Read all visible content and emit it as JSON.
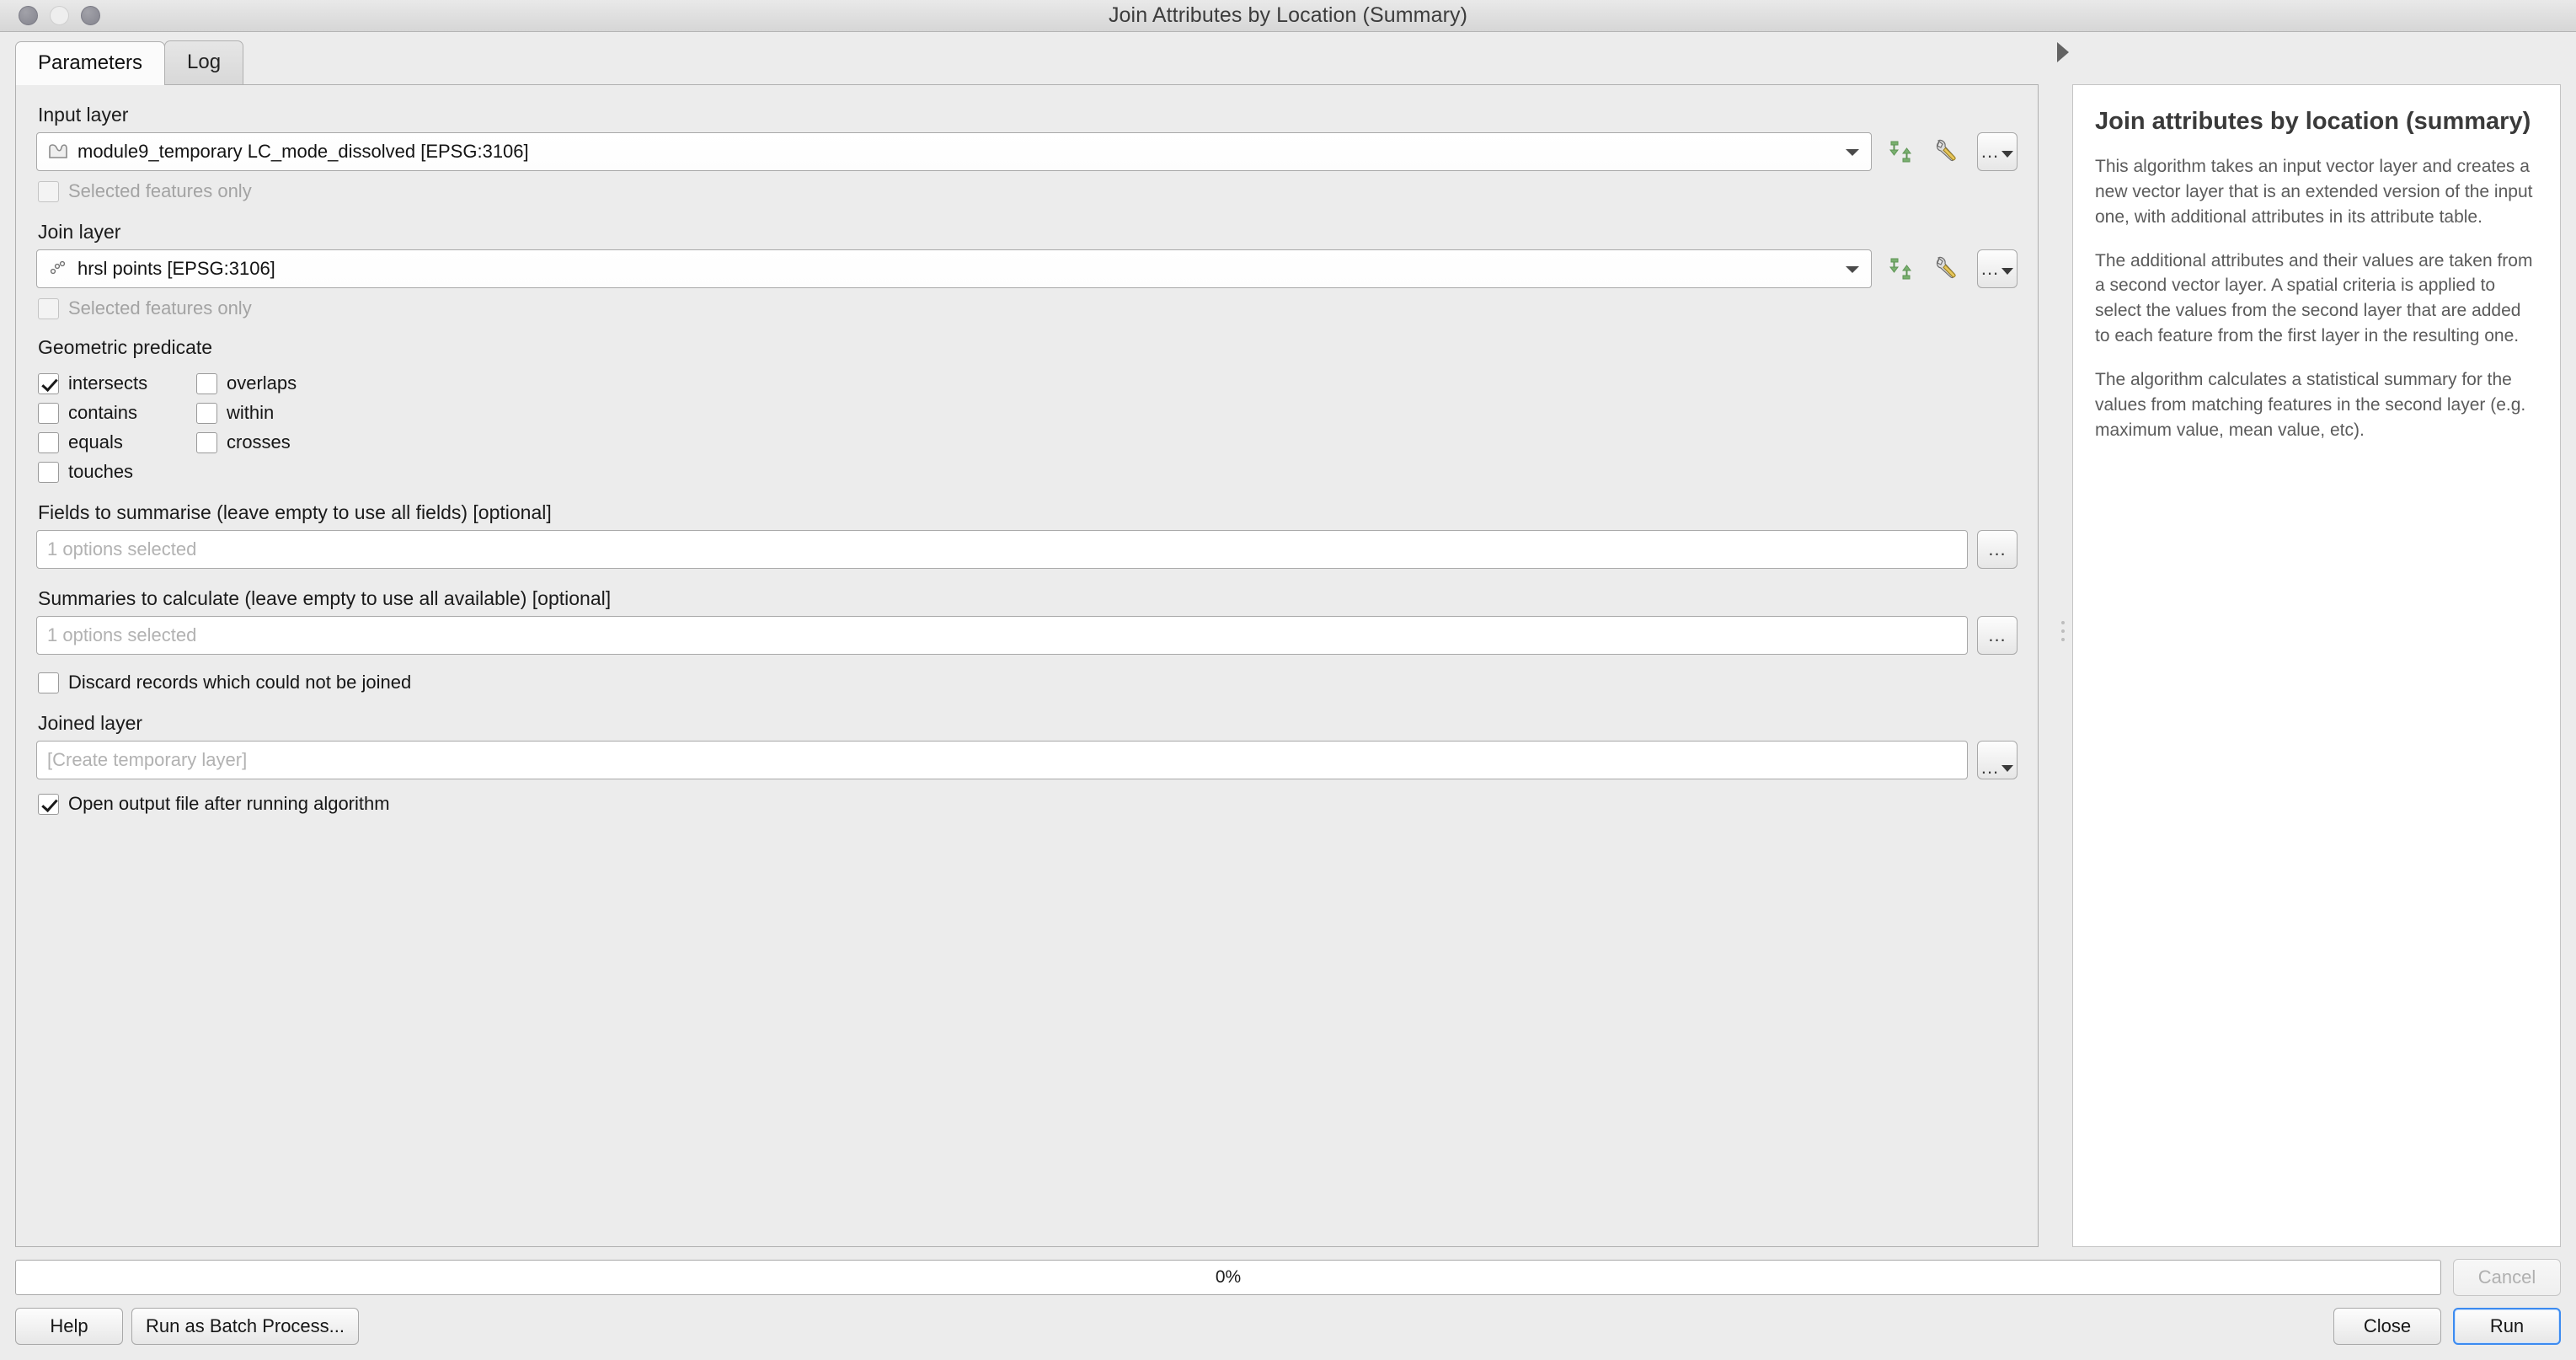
{
  "window": {
    "title": "Join Attributes by Location (Summary)",
    "traffic_lights": [
      "close-button",
      "minimize-button",
      "zoom-button"
    ]
  },
  "tabs": [
    {
      "label": "Parameters",
      "active": true
    },
    {
      "label": "Log",
      "active": false
    }
  ],
  "parameters": {
    "input_layer": {
      "label": "Input layer",
      "value": "module9_temporary LC_mode_dissolved [EPSG:3106]",
      "icon": "polygon-layer-icon",
      "selected_features_only": {
        "label": "Selected features only",
        "checked": false,
        "disabled": true
      },
      "buttons": [
        "iterate-icon",
        "wrench-icon",
        "more-options-button"
      ]
    },
    "join_layer": {
      "label": "Join layer",
      "value": "hrsl points [EPSG:3106]",
      "icon": "point-layer-icon",
      "selected_features_only": {
        "label": "Selected features only",
        "checked": false,
        "disabled": true
      },
      "buttons": [
        "iterate-icon",
        "wrench-icon",
        "more-options-button"
      ]
    },
    "geometric_predicate": {
      "label": "Geometric predicate",
      "options": [
        {
          "label": "intersects",
          "checked": true
        },
        {
          "label": "overlaps",
          "checked": false
        },
        {
          "label": "contains",
          "checked": false
        },
        {
          "label": "within",
          "checked": false
        },
        {
          "label": "equals",
          "checked": false
        },
        {
          "label": "crosses",
          "checked": false
        },
        {
          "label": "touches",
          "checked": false
        }
      ]
    },
    "fields_to_summarise": {
      "label": "Fields to summarise (leave empty to use all fields) [optional]",
      "value": "1 options selected",
      "button": "..."
    },
    "summaries_to_calculate": {
      "label": "Summaries to calculate (leave empty to use all available) [optional]",
      "value": "1 options selected",
      "button": "..."
    },
    "discard_records": {
      "label": "Discard records which could not be joined",
      "checked": false
    },
    "joined_layer": {
      "label": "Joined layer",
      "value": "[Create temporary layer]",
      "button": "..."
    },
    "open_output": {
      "label": "Open output file after running algorithm",
      "checked": true
    }
  },
  "help": {
    "title": "Join attributes by location (summary)",
    "paragraphs": [
      "This algorithm takes an input vector layer and creates a new vector layer that is an extended version of the input one, with additional attributes in its attribute table.",
      "The additional attributes and their values are taken from a second vector layer. A spatial criteria is applied to select the values from the second layer that are added to each feature from the first layer in the resulting one.",
      "The algorithm calculates a statistical summary for the values from matching features in the second layer (e.g. maximum value, mean value, etc)."
    ]
  },
  "footer": {
    "progress_text": "0%",
    "progress_percent": 0,
    "help_label": "Help",
    "batch_label": "Run as Batch Process...",
    "cancel_label": "Cancel",
    "cancel_disabled": true,
    "close_label": "Close",
    "run_label": "Run"
  },
  "colors": {
    "accent": "#3c8bf0",
    "iterate_green": "#6eaa68",
    "window_bg": "#ececec",
    "panel_bg": "#ffffff"
  }
}
